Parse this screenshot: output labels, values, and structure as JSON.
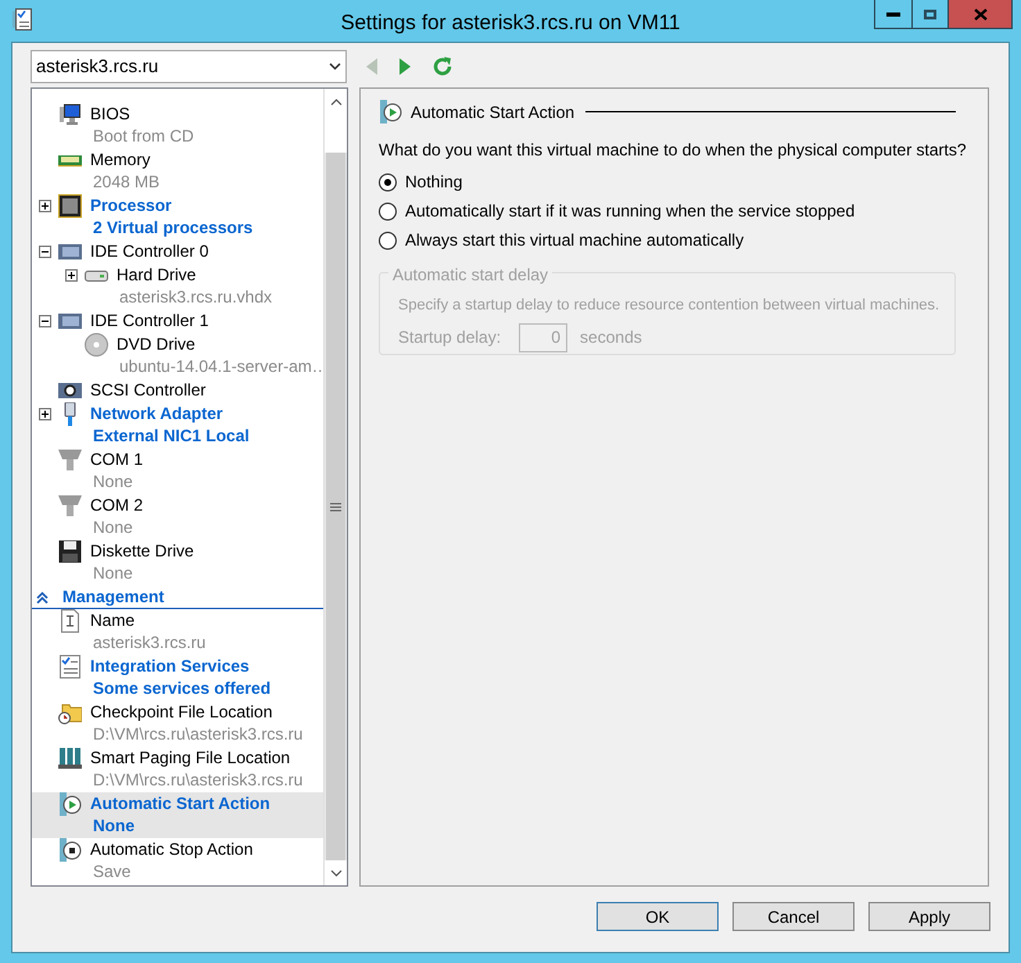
{
  "window": {
    "title": "Settings for asterisk3.rcs.ru on VM11"
  },
  "vm_selector": {
    "value": "asterisk3.rcs.ru"
  },
  "toolbar": [
    {
      "kind": "back",
      "disabled": true
    },
    {
      "kind": "forward",
      "disabled": false
    },
    {
      "kind": "refresh",
      "disabled": false
    }
  ],
  "hardware_items": [
    {
      "kind": "bios",
      "label": "BIOS",
      "detail": "Boot from CD",
      "emphasized": false,
      "selected": false
    },
    {
      "kind": "memory",
      "label": "Memory",
      "detail": "2048 MB",
      "emphasized": false,
      "selected": false
    },
    {
      "kind": "processor",
      "label": "Processor",
      "detail": "2 Virtual processors",
      "emphasized": true,
      "expanded": false,
      "selected": false
    },
    {
      "kind": "controller",
      "label": "IDE Controller 0",
      "emphasized": false,
      "expanded": true,
      "selected": false,
      "children": [
        {
          "kind": "disk",
          "label": "Hard Drive",
          "detail": "asterisk3.rcs.ru.vhdx",
          "emphasized": false,
          "expanded": false,
          "selected": false
        }
      ]
    },
    {
      "kind": "controller",
      "label": "IDE Controller 1",
      "emphasized": false,
      "expanded": true,
      "selected": false,
      "children": [
        {
          "kind": "dvd",
          "label": "DVD Drive",
          "detail": "ubuntu-14.04.1-server-am…",
          "emphasized": false,
          "selected": false
        }
      ]
    },
    {
      "kind": "scsi",
      "label": "SCSI Controller",
      "emphasized": false,
      "selected": false
    },
    {
      "kind": "network",
      "label": "Network Adapter",
      "detail": "External NIC1 Local",
      "emphasized": true,
      "expanded": false,
      "selected": false
    },
    {
      "kind": "com",
      "label": "COM 1",
      "detail": "None",
      "emphasized": false,
      "selected": false
    },
    {
      "kind": "com",
      "label": "COM 2",
      "detail": "None",
      "emphasized": false,
      "selected": false
    },
    {
      "kind": "floppy",
      "label": "Diskette Drive",
      "detail": "None",
      "emphasized": false,
      "selected": false
    }
  ],
  "management_section": {
    "label": "Management",
    "expanded": true,
    "items": [
      {
        "kind": "name",
        "label": "Name",
        "detail": "asterisk3.rcs.ru",
        "emphasized": false,
        "selected": false
      },
      {
        "kind": "services",
        "label": "Integration Services",
        "detail": "Some services offered",
        "emphasized": true,
        "selected": false
      },
      {
        "kind": "checkpoint",
        "label": "Checkpoint File Location",
        "detail": "D:\\VM\\rcs.ru\\asterisk3.rcs.ru",
        "emphasized": false,
        "selected": false
      },
      {
        "kind": "paging",
        "label": "Smart Paging File Location",
        "detail": "D:\\VM\\rcs.ru\\asterisk3.rcs.ru",
        "emphasized": false,
        "selected": false
      },
      {
        "kind": "start",
        "label": "Automatic Start Action",
        "detail": "None",
        "emphasized": true,
        "selected": true
      },
      {
        "kind": "stop",
        "label": "Automatic Stop Action",
        "detail": "Save",
        "emphasized": false,
        "selected": false
      }
    ]
  },
  "details": {
    "title": "Automatic Start Action",
    "question": "What do you want this virtual machine to do when the physical computer starts?",
    "options": [
      {
        "label": "Nothing",
        "selected": true
      },
      {
        "label": "Automatically start if it was running when the service stopped",
        "selected": false
      },
      {
        "label": "Always start this virtual machine automatically",
        "selected": false
      }
    ],
    "delay_group": {
      "title": "Automatic start delay",
      "disabled": true,
      "description": "Specify a startup delay to reduce resource contention between virtual machines.",
      "field_label": "Startup delay:",
      "value": "0",
      "unit": "seconds"
    }
  },
  "buttons": [
    {
      "label": "OK",
      "default": true
    },
    {
      "label": "Cancel",
      "default": false
    },
    {
      "label": "Apply",
      "default": false
    }
  ]
}
